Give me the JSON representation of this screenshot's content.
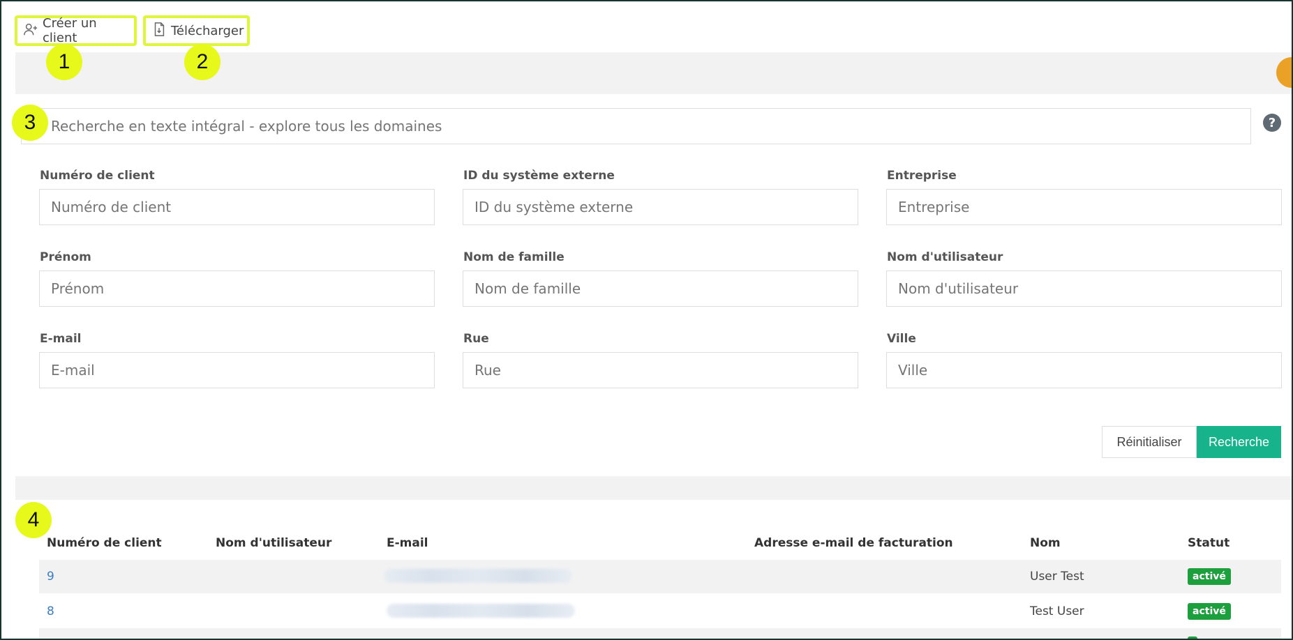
{
  "toolbar": {
    "create_label": "Créer un client",
    "download_label": "Télécharger"
  },
  "badges": [
    "1",
    "2",
    "3",
    "4"
  ],
  "search": {
    "fulltext_placeholder": "Recherche en texte intégral - explore tous les domaines",
    "help": "?"
  },
  "fields": [
    {
      "label": "Numéro de client",
      "placeholder": "Numéro de client"
    },
    {
      "label": "ID du système externe",
      "placeholder": "ID du système externe"
    },
    {
      "label": "Entreprise",
      "placeholder": "Entreprise"
    },
    {
      "label": "Prénom",
      "placeholder": "Prénom"
    },
    {
      "label": "Nom de famille",
      "placeholder": "Nom de famille"
    },
    {
      "label": "Nom d'utilisateur",
      "placeholder": "Nom d'utilisateur"
    },
    {
      "label": "E-mail",
      "placeholder": "E-mail"
    },
    {
      "label": "Rue",
      "placeholder": "Rue"
    },
    {
      "label": "Ville",
      "placeholder": "Ville"
    }
  ],
  "actions": {
    "reset": "Réinitialiser",
    "search": "Recherche"
  },
  "table": {
    "headers": [
      "Numéro de client",
      "Nom d'utilisateur",
      "E-mail",
      "Adresse e-mail de facturation",
      "Nom",
      "Statut"
    ],
    "rows": [
      {
        "id": "9",
        "name": "User Test",
        "status": "activé"
      },
      {
        "id": "8",
        "name": "Test User",
        "status": "activé"
      }
    ]
  },
  "colors": {
    "highlight": "#dff53a",
    "badge": "#e6f91b",
    "primary": "#17b48c",
    "status": "#1e9f3e",
    "link": "#3d7dbf"
  }
}
